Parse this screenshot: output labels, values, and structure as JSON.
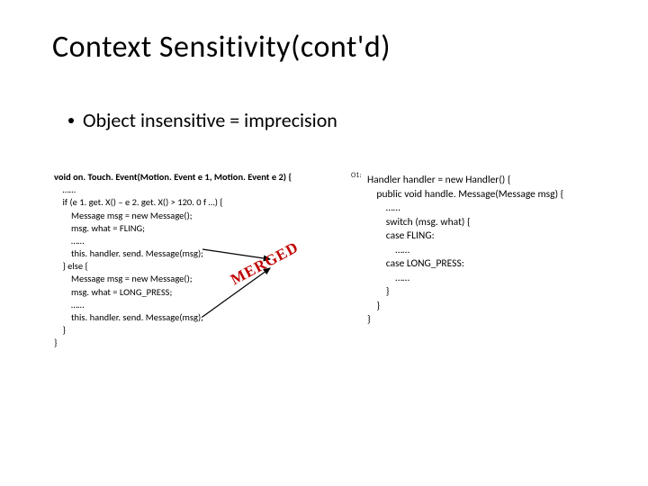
{
  "title": "Context Sensitivity(cont'd)",
  "subtitle": "Object insensitive  = imprecision",
  "o1_label": "O1:",
  "merged_label": "MERGED",
  "code_left": {
    "l0": "void on. Touch. Event(Motion. Event e 1, Motion. Event e 2) {",
    "l1": "    ……",
    "l2": "    if (e 1. get. X() – e 2. get. X() > 120. 0 f …) {",
    "l3": "        Message msg = new Message();",
    "l4": "        msg. what = FLING;",
    "l5": "        ……",
    "l6": "        this. handler. send. Message(msg);",
    "l7": "    } else {",
    "l8": "        Message msg = new Message();",
    "l9": "        msg. what = LONG_PRESS;",
    "l10": "        ……",
    "l11": "        this. handler. send. Message(msg);",
    "l12": "    }",
    "l13": "}"
  },
  "code_right": {
    "r0": "Handler handler = new Handler() {",
    "r1": "    public void handle. Message(Message msg) {",
    "r2": "        ……",
    "r3": "        switch (msg. what) {",
    "r4": "        case FLING:",
    "r5": "            ……",
    "r6": "        case LONG_PRESS:",
    "r7": "            ……",
    "r8": "        }",
    "r9": "    }",
    "r10": "}"
  }
}
